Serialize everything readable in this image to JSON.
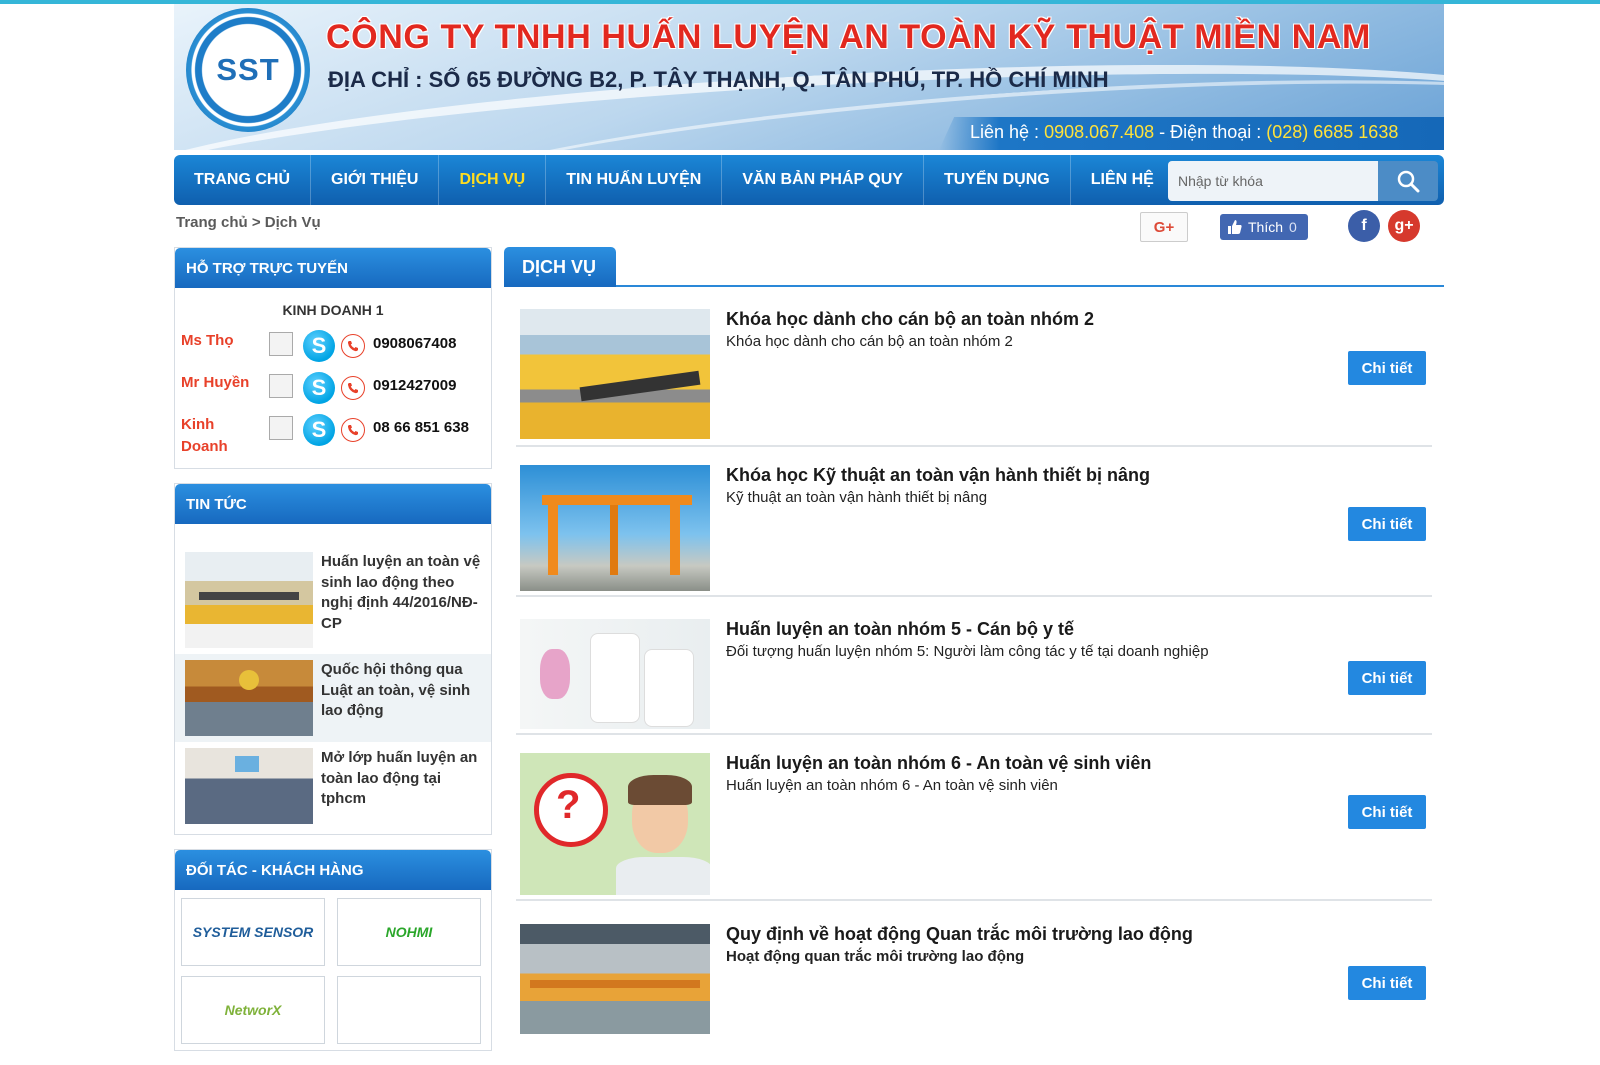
{
  "header": {
    "logo_text": "SST",
    "company_name": "CÔNG TY TNHH HUẤN LUYỆN AN TOÀN KỸ THUẬT MIỀN NAM",
    "address": "ĐỊA CHỈ : SỐ 65 ĐƯỜNG B2, P. TÂY THẠNH, Q. TÂN PHÚ, TP. HỒ CHÍ MINH",
    "contact_label": "Liên hệ : ",
    "contact_phone": "0908.067.408",
    "phone_label": " - Điện thoại : ",
    "office_phone": "(028) 6685 1638"
  },
  "nav": {
    "items": [
      "TRANG CHỦ",
      "GIỚI THIỆU",
      "DỊCH VỤ",
      "TIN HUẤN LUYỆN",
      "VĂN BẢN PHÁP QUY",
      "TUYỂN DỤNG",
      "LIÊN HỆ"
    ],
    "active": "DỊCH VỤ",
    "search_placeholder": "Nhập từ khóa"
  },
  "breadcrumb": {
    "home": "Trang chủ",
    "separator": " > ",
    "current": "Dịch Vụ"
  },
  "social": {
    "gplus_label": "G+",
    "like_label": "Thích",
    "like_count": "0",
    "facebook_letter": "f",
    "googleplus_letter": "g+"
  },
  "support": {
    "title": "HỖ TRỢ TRỰC TUYẾN",
    "group": "KINH DOANH 1",
    "contacts": [
      {
        "name": "Ms Thọ",
        "phone": "0908067408"
      },
      {
        "name": "Mr Huyền",
        "phone": "0912427009"
      },
      {
        "name": "Kinh Doanh",
        "phone": "08 66 851 638"
      }
    ]
  },
  "news": {
    "title": "TIN TỨC",
    "items": [
      "Huấn luyện an toàn vệ sinh lao động theo nghị định 44/2016/NĐ-CP",
      "Quốc hội thông qua Luật an toàn, vệ sinh lao động",
      "Mở lớp huấn luyện an toàn lao động tại tphcm"
    ]
  },
  "partners": {
    "title": "ĐỐI TÁC - KHÁCH HÀNG",
    "logos": [
      "SYSTEM SENSOR",
      "NOHMI",
      "NetworX",
      ""
    ]
  },
  "main": {
    "tab": "DỊCH VỤ",
    "button_label": "Chi tiết",
    "services": [
      {
        "title": "Khóa học dành cho cán bộ an toàn nhóm 2",
        "desc": "Khóa học dành cho cán bộ an toàn nhóm 2"
      },
      {
        "title": "Khóa học Kỹ thuật an toàn vận hành thiết bị nâng",
        "desc": "Kỹ thuật an toàn vận hành thiết bị nâng"
      },
      {
        "title": "Huấn luyện an toàn nhóm 5 - Cán bộ y tế",
        "desc": "Đối tượng huấn luyện nhóm 5: Người làm công tác y tế tại doanh nghiệp"
      },
      {
        "title": "Huấn luyện an toàn nhóm 6 - An toàn vệ sinh viên",
        "desc": "Huấn luyện an toàn nhóm 6 - An toàn vệ sinh viên"
      },
      {
        "title": "Quy định về hoạt động Quan trắc môi trường lao động",
        "desc": "Hoạt động quan trắc môi trường lao động"
      }
    ]
  },
  "colors": {
    "accent": "#1b86d6",
    "nav_active": "#ffdd1f",
    "brand_red": "#e2281f",
    "button": "#2388e0"
  }
}
